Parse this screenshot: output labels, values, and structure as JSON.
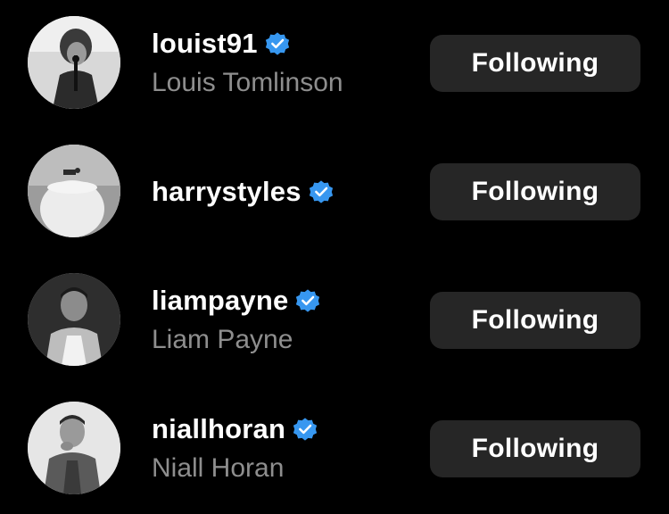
{
  "accounts": [
    {
      "username": "louist91",
      "full_name": "Louis Tomlinson",
      "verified": true,
      "button_label": "Following"
    },
    {
      "username": "harrystyles",
      "full_name": "",
      "verified": true,
      "button_label": "Following"
    },
    {
      "username": "liampayne",
      "full_name": "Liam Payne",
      "verified": true,
      "button_label": "Following"
    },
    {
      "username": "niallhoran",
      "full_name": "Niall Horan",
      "verified": true,
      "button_label": "Following"
    }
  ],
  "colors": {
    "background": "#000000",
    "button_background": "#262626",
    "secondary_text": "#8e8e8e",
    "verified_badge": "#3797f0"
  },
  "icons": {
    "verified": "verified-badge-icon"
  }
}
